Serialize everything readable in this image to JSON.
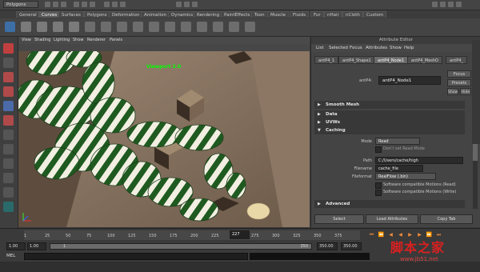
{
  "status_line": {
    "menu_set": "Polygons"
  },
  "shelf": {
    "tabs": [
      "General",
      "Curves",
      "Surfaces",
      "Polygons",
      "Deformation",
      "Animation",
      "Dynamics",
      "Rendering",
      "PaintEffects",
      "Toon",
      "Muscle",
      "Fluids",
      "Fur",
      "nHair",
      "nCloth",
      "Custom"
    ],
    "active_tab": 1
  },
  "viewport": {
    "menus": [
      "View",
      "Shading",
      "Lighting",
      "Show",
      "Renderer",
      "Panels"
    ],
    "label": "Viewport 2.0"
  },
  "attribute_editor": {
    "title": "Attribute Editor",
    "menus": [
      "List",
      "Selected",
      "Focus",
      "Attributes",
      "Show",
      "Help"
    ],
    "tabs": [
      "antP4_1",
      "antP4_Shape1",
      "antP4_Node1",
      "antP4_MeshO",
      "antP4_"
    ],
    "active_tab": 2,
    "node_label": "antP4:",
    "node_name": "antP4_Node1",
    "side_buttons": [
      "Focus",
      "Presets",
      "Show",
      "Hide"
    ],
    "sections": {
      "smooth_mesh": "Smooth Mesh",
      "uvs": "UVWs",
      "caching": "Caching",
      "advanced": "Advanced",
      "data": "Data"
    },
    "caching": {
      "mode_label": "Mode",
      "mode_value": "Read",
      "check_label": "Don't set Read Mode",
      "path_label": "Path",
      "path_value": "C:/Users/cache/high",
      "filename_label": "Filename",
      "filename_value": "cache_file",
      "fileformat_label": "Fileformat",
      "fileformat_value": "RealFlow (.bin)",
      "opt1": "Software compatible Motions (Read)",
      "opt2": "Software compatible Motions (Write)"
    },
    "bottom_buttons": [
      "Select",
      "Load Attributes",
      "Copy Tab"
    ]
  },
  "time_slider": {
    "ticks": [
      "1",
      "25",
      "50",
      "75",
      "100",
      "125",
      "150",
      "175",
      "200",
      "225",
      "250",
      "275",
      "300",
      "325",
      "350",
      "375"
    ],
    "current_frame": "227"
  },
  "range_slider": {
    "start": "1.00",
    "inner_start": "1.00",
    "inner_small": "1",
    "inner_end": "350",
    "end": "350.00",
    "end2": "350.00"
  },
  "command_line": {
    "label": "MEL"
  },
  "watermark": {
    "cn": "脚本之家",
    "url": "www.jb51.net"
  },
  "colors": {
    "accent_orange": "#f08a3a",
    "viewport_bg": "#7d6a58",
    "green_stripe": "#1f5a20"
  }
}
